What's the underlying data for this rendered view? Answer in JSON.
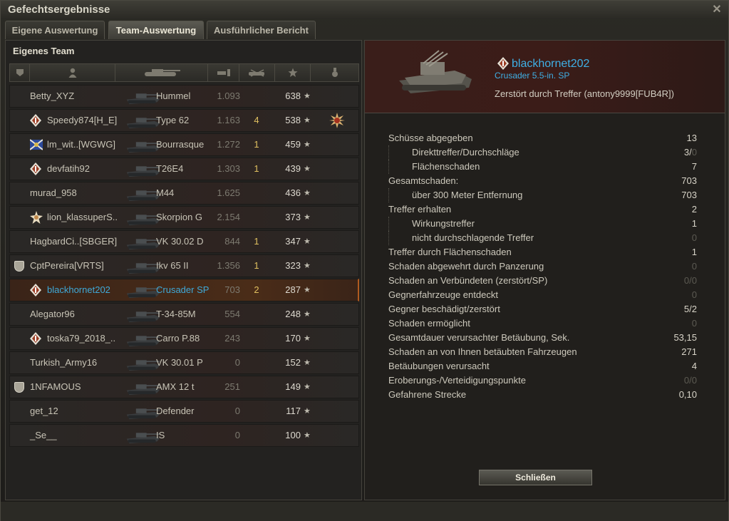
{
  "window": {
    "title": "Gefechtsergebnisse"
  },
  "tabs": [
    {
      "label": "Eigene Auswertung",
      "active": false
    },
    {
      "label": "Team-Auswertung",
      "active": true
    },
    {
      "label": "Ausführlicher Bericht",
      "active": false
    }
  ],
  "team": {
    "title": "Eigenes Team",
    "header_icons": [
      "platoon-icon",
      "player-icon",
      "vehicle-icon",
      "damage-icon",
      "kills-icon",
      "xp-icon",
      "medal-icon"
    ],
    "rows": [
      {
        "name": "Betty_XYZ",
        "tank": "Hummel",
        "xp": "1.093",
        "kills": "",
        "score": "638",
        "badge": "",
        "medal": false,
        "me": false,
        "clan_shield": false
      },
      {
        "name": "Speedy874[H_E]",
        "tank": "Type 62",
        "xp": "1.163",
        "kills": "4",
        "score": "538",
        "badge": "diamond",
        "medal": true,
        "me": false,
        "clan_shield": false
      },
      {
        "name": "lm_wit..[WGWG]",
        "tank": "Bourrasque",
        "xp": "1.272",
        "kills": "1",
        "score": "459",
        "badge": "flag",
        "medal": false,
        "me": false,
        "clan_shield": false
      },
      {
        "name": "devfatih92",
        "tank": "T26E4",
        "xp": "1.303",
        "kills": "1",
        "score": "439",
        "badge": "diamond",
        "medal": false,
        "me": false,
        "clan_shield": false
      },
      {
        "name": "murad_958",
        "tank": "M44",
        "xp": "1.625",
        "kills": "",
        "score": "436",
        "badge": "",
        "medal": false,
        "me": false,
        "clan_shield": false
      },
      {
        "name": "lion_klassuperS..",
        "tank": "Skorpion G",
        "xp": "2.154",
        "kills": "",
        "score": "373",
        "badge": "star",
        "medal": false,
        "me": false,
        "clan_shield": false
      },
      {
        "name": "HagbardCi..[SBGER]",
        "tank": "VK 30.02 D",
        "xp": "844",
        "kills": "1",
        "score": "347",
        "badge": "",
        "medal": false,
        "me": false,
        "clan_shield": false
      },
      {
        "name": "CptPereira[VRTS]",
        "tank": "Ikv 65 II",
        "xp": "1.356",
        "kills": "1",
        "score": "323",
        "badge": "",
        "medal": false,
        "me": false,
        "clan_shield": true
      },
      {
        "name": "blackhornet202",
        "tank": "Crusader SP",
        "xp": "703",
        "kills": "2",
        "score": "287",
        "badge": "diamond",
        "medal": false,
        "me": true,
        "clan_shield": false
      },
      {
        "name": "Alegator96",
        "tank": "T-34-85M",
        "xp": "554",
        "kills": "",
        "score": "248",
        "badge": "",
        "medal": false,
        "me": false,
        "clan_shield": false
      },
      {
        "name": "toska79_2018_..",
        "tank": "Carro P.88",
        "xp": "243",
        "kills": "",
        "score": "170",
        "badge": "diamond",
        "medal": false,
        "me": false,
        "clan_shield": false
      },
      {
        "name": "Turkish_Army16",
        "tank": "VK 30.01 P",
        "xp": "0",
        "kills": "",
        "score": "152",
        "badge": "",
        "medal": false,
        "me": false,
        "clan_shield": false
      },
      {
        "name": "1NFAMOUS",
        "tank": "AMX 12 t",
        "xp": "251",
        "kills": "",
        "score": "149",
        "badge": "",
        "medal": false,
        "me": false,
        "clan_shield": true
      },
      {
        "name": "get_12",
        "tank": "Defender",
        "xp": "0",
        "kills": "",
        "score": "117",
        "badge": "",
        "medal": false,
        "me": false,
        "clan_shield": false
      },
      {
        "name": "_Se__",
        "tank": "IS",
        "xp": "0",
        "kills": "",
        "score": "100",
        "badge": "",
        "medal": false,
        "me": false,
        "clan_shield": false
      }
    ]
  },
  "detail": {
    "player": "blackhornet202",
    "vehicle": "Crusader 5.5-in. SP",
    "status": "Zerstört durch Treffer (antony9999[FUB4R])",
    "stats": [
      {
        "label": "Schüsse abgegeben",
        "value": "13",
        "sub": false,
        "dim": false
      },
      {
        "label": "Direkttreffer/Durchschläge",
        "value": "3/",
        "value_dim": "0",
        "sub": true,
        "dim": false
      },
      {
        "label": "Flächenschaden",
        "value": "7",
        "sub": true,
        "dim": false
      },
      {
        "label": "Gesamtschaden:",
        "value": "703",
        "sub": false,
        "dim": false
      },
      {
        "label": "über 300 Meter Entfernung",
        "value": "703",
        "sub": true,
        "dim": false
      },
      {
        "label": "Treffer erhalten",
        "value": "2",
        "sub": false,
        "dim": false
      },
      {
        "label": "Wirkungstreffer",
        "value": "1",
        "sub": true,
        "dim": false
      },
      {
        "label": "nicht durchschlagende Treffer",
        "value": "0",
        "sub": true,
        "dim": true
      },
      {
        "label": "Treffer durch Flächenschaden",
        "value": "1",
        "sub": false,
        "dim": false
      },
      {
        "label": "Schaden abgewehrt durch Panzerung",
        "value": "0",
        "sub": false,
        "dim": true
      },
      {
        "label": "Schaden an Verbündeten (zerstört/SP)",
        "value": "0/0",
        "sub": false,
        "dim": true
      },
      {
        "label": "Gegnerfahrzeuge entdeckt",
        "value": "0",
        "sub": false,
        "dim": true
      },
      {
        "label": "Gegner beschädigt/zerstört",
        "value": "5/2",
        "sub": false,
        "dim": false
      },
      {
        "label": "Schaden ermöglicht",
        "value": "0",
        "sub": false,
        "dim": true
      },
      {
        "label": "Gesamtdauer verursachter Betäubung, Sek.",
        "value": "53,15",
        "sub": false,
        "dim": false
      },
      {
        "label": "Schaden an von Ihnen betäubten Fahrzeugen",
        "value": "271",
        "sub": false,
        "dim": false
      },
      {
        "label": "Betäubungen verursacht",
        "value": "4",
        "sub": false,
        "dim": false
      },
      {
        "label": "Eroberungs-/Verteidigungspunkte",
        "value": "0/0",
        "sub": false,
        "dim": true
      },
      {
        "label": "Gefahrene Strecke",
        "value": "0,10",
        "sub": false,
        "dim": false
      }
    ],
    "close_label": "Schließen"
  }
}
